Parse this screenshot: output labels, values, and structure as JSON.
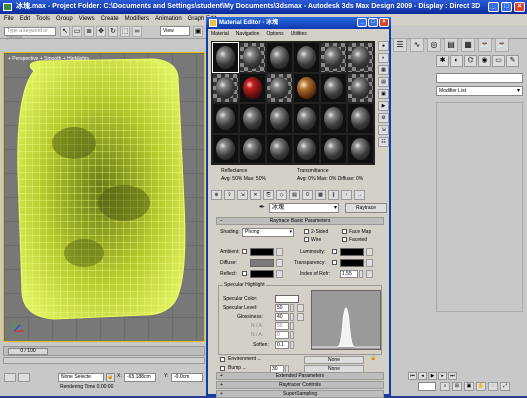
{
  "window": {
    "title": "冰塊.max - Project Folder: C:\\Documents and Settings\\student\\My Documents\\3dsmax - Autodesk 3ds Max Design 2009 - Display : Direct 3D"
  },
  "menubar": [
    "File",
    "Edit",
    "Tools",
    "Group",
    "Views",
    "Create",
    "Modifiers",
    "Animation",
    "Graph Edit"
  ],
  "toolbar": {
    "search_placeholder": "Type a keyword or phrase",
    "view_select": "View"
  },
  "viewport": {
    "label": "+ Perspective + Smooth + Highlights"
  },
  "right_panel": {
    "modifier_list": "Modifier List"
  },
  "timeline": {
    "thumb": "0 / 100"
  },
  "status": {
    "selection": "None Selecte",
    "x_label": "X:",
    "x_value": "-65.188cm",
    "y_label": "Y:",
    "y_value": "-0.0cm",
    "render_time": "Rendering Time  0:00:00"
  },
  "material_editor": {
    "title": "Material Editor - 冰塊",
    "menu": [
      "Material",
      "Navigation",
      "Options",
      "Utilities"
    ],
    "reflectance_label": "Reflectance",
    "reflectance_vals": "Avg:  50% Max:  50%",
    "transmittance_label": "Transmittance",
    "transmittance_vals": "Avg:  0% Max:  0% Diffuse:  0%",
    "material_name": "冰塊",
    "type_button": "Raytrace",
    "rollout_basic": "Raytrace Basic Parameters",
    "shading_label": "Shading:",
    "shading_value": "Phong",
    "opt_2sided": "2-Sided",
    "opt_facemap": "Face Map",
    "opt_wire": "Wire",
    "opt_faceted": "Faceted",
    "ambient_label": "Ambient:",
    "diffuse_label": "Diffuse:",
    "reflect_label": "Reflect:",
    "luminosity_label": "Luminosity:",
    "transparency_label": "Transparency:",
    "ior_label": "Index of Refr:",
    "ior_value": "1.55",
    "specular_group": "Specular Highlight",
    "spec_color_label": "Specular Color:",
    "spec_level_label": "Specular Level:",
    "spec_level_value": "50",
    "glossiness_label": "Glossiness:",
    "glossiness_value": "40",
    "na1_label": "N / A:",
    "na1_value": "50",
    "na2_label": "N / A:",
    "na2_value": "0",
    "soften_label": "Soften:",
    "soften_value": "0.1",
    "environment_label": "Environment ...",
    "environment_map": "None",
    "bump_label": "Bump ...",
    "bump_amount": "30",
    "bump_map": "None",
    "rollout_extended": "Extended Parameters",
    "rollout_controls": "Raytracer Controls",
    "rollout_supersampling": "SuperSampling",
    "colors": {
      "ambient": "#000000",
      "diffuse": "#7a7a7a",
      "reflect": "#000000",
      "transparency": "#000000",
      "spec_color": "#ffffff"
    }
  }
}
